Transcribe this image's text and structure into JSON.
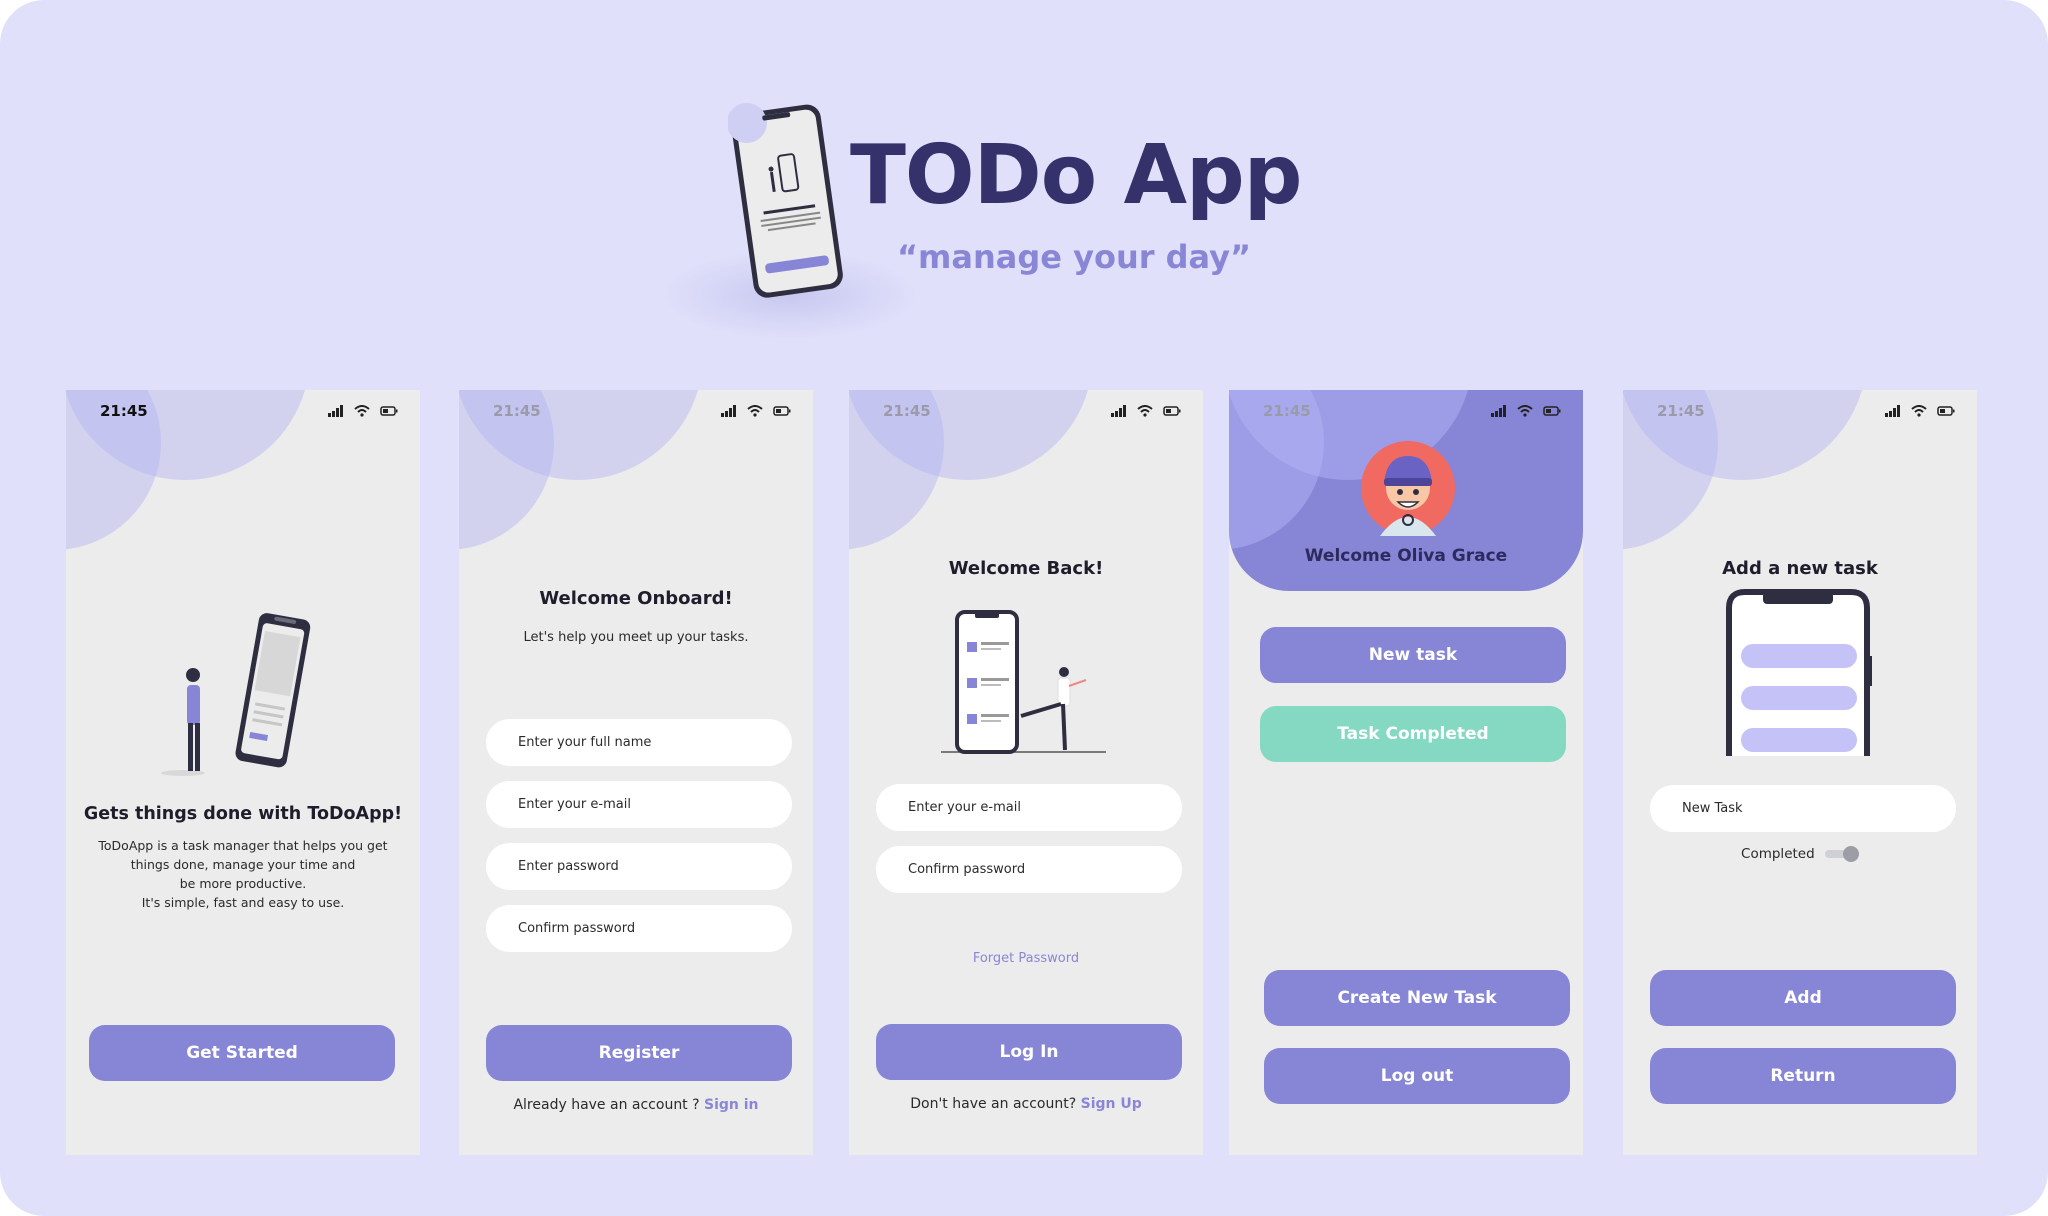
{
  "hero": {
    "title": "TODo App",
    "subtitle": "“manage your day”"
  },
  "colors": {
    "background": "#e0e0fb",
    "accent": "#8785d6",
    "accent_dark": "#34316b",
    "success": "#85d9c2",
    "screen_bg": "#ececec"
  },
  "screens": [
    {
      "time": "21:45",
      "heading": "Gets things done with ToDoApp!",
      "body": "ToDoApp is a task manager that helps you get\nthings done, manage your time and\nbe more productive.\nIt's simple, fast and easy to use.",
      "button": "Get Started"
    },
    {
      "time": "21:45",
      "heading": "Welcome Onboard!",
      "subheading": "Let's help you meet up your tasks.",
      "fields": [
        "Enter your full name",
        "Enter your  e-mail",
        "Enter password",
        "Confirm password"
      ],
      "button": "Register",
      "footer_text": "Already have an account ? ",
      "footer_link": "Sign in"
    },
    {
      "time": "21:45",
      "heading": "Welcome Back!",
      "fields": [
        "Enter your e-mail",
        "Confirm password"
      ],
      "forgot": "Forget Password",
      "button": "Log In",
      "footer_text": "Don't have an account? ",
      "footer_link": "Sign Up"
    },
    {
      "time": "21:45",
      "welcome": "Welcome Oliva Grace",
      "buttons": [
        "New task",
        "Task Completed",
        "Create New Task",
        "Log out"
      ]
    },
    {
      "time": "21:45",
      "heading": "Add a new task",
      "field": "New Task",
      "toggle_label": "Completed",
      "buttons": [
        "Add",
        "Return"
      ]
    }
  ],
  "icons": [
    "signal-icon",
    "wifi-icon",
    "battery-icon"
  ]
}
